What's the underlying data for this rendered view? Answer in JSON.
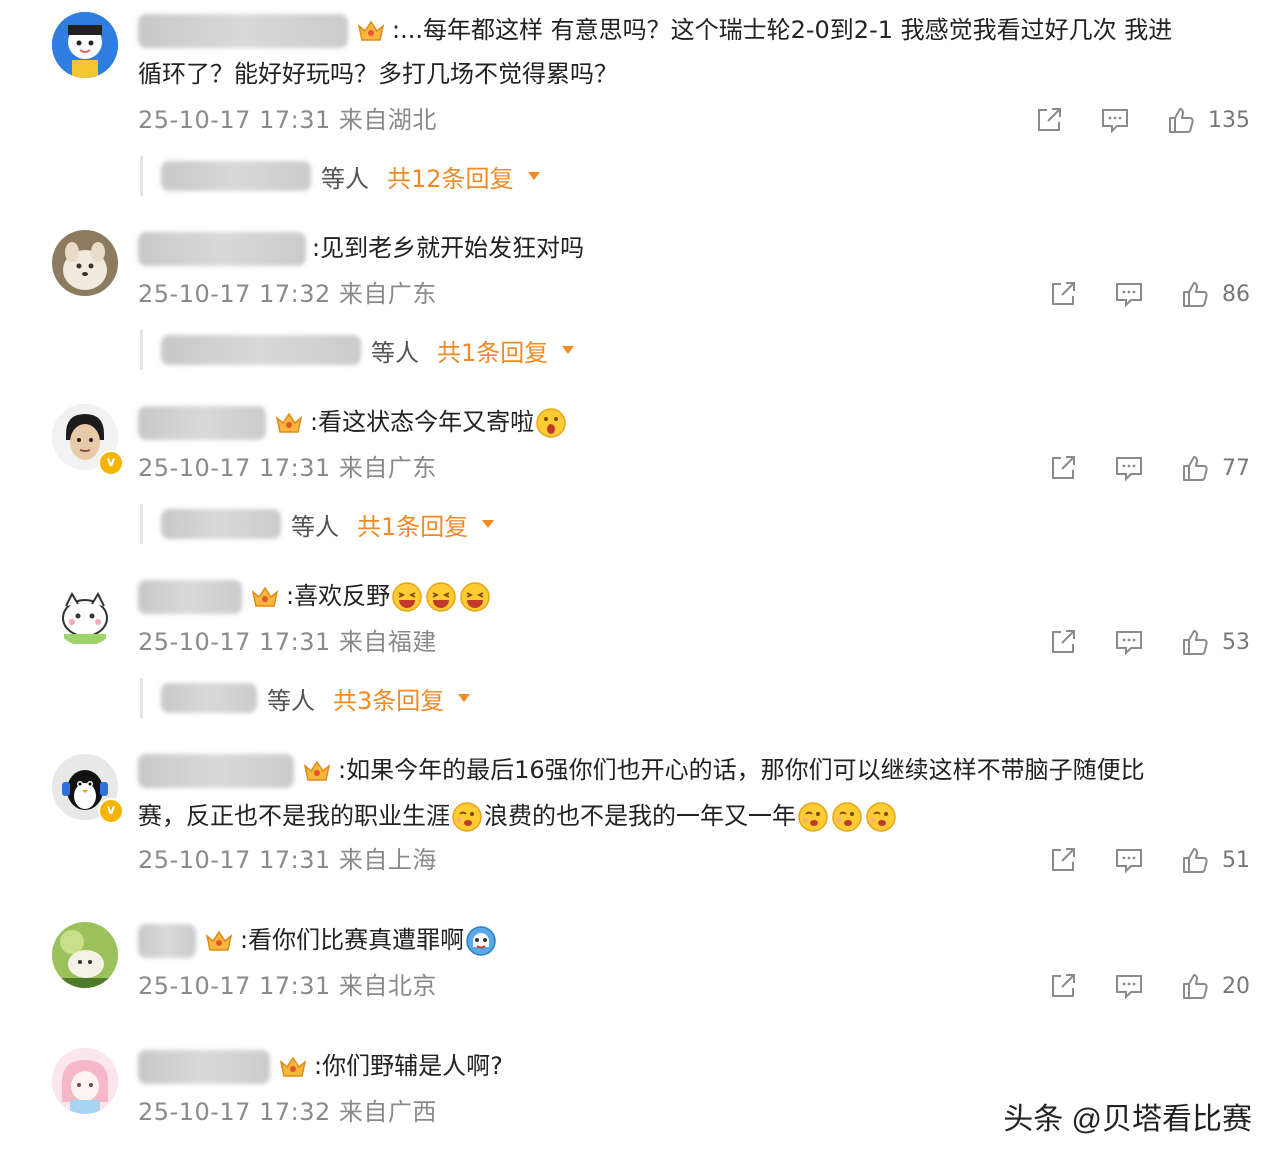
{
  "colors": {
    "accent": "#f08a24",
    "meta": "#8a8a8a",
    "text": "#222222"
  },
  "comments": [
    {
      "text_l1": ":...每年都这样 有意思吗？这个瑞士轮2-0到2-1 我感觉我看过好几次 我进",
      "text_l2": "循环了？能好好玩吗？多打几场不觉得累吗？",
      "time": "25-10-17 17:31",
      "location": "来自湖北",
      "likes": "135",
      "reply_who": "等人",
      "reply_total": "共12条回复"
    },
    {
      "text_l1": ":见到老乡就开始发狂对吗",
      "time": "25-10-17 17:32",
      "location": "来自广东",
      "likes": "86",
      "reply_who": "等人",
      "reply_total": "共1条回复"
    },
    {
      "text_l1": ":看这状态今年又寄啦",
      "time": "25-10-17 17:31",
      "location": "来自广东",
      "likes": "77",
      "reply_who": "等人",
      "reply_total": "共1条回复"
    },
    {
      "text_l1": ":喜欢反野",
      "time": "25-10-17 17:31",
      "location": "来自福建",
      "likes": "53",
      "reply_who": "等人",
      "reply_total": "共3条回复"
    },
    {
      "text_l1": ":如果今年的最后16强你们也开心的话，那你们可以继续这样不带脑子随便比",
      "text_l2a": "赛，反正也不是我的职业生涯",
      "text_l2b": "浪费的也不是我的一年又一年",
      "time": "25-10-17 17:31",
      "location": "来自上海",
      "likes": "51"
    },
    {
      "text_l1": ":看你们比赛真遭罪啊",
      "time": "25-10-17 17:31",
      "location": "来自北京",
      "likes": "20"
    },
    {
      "text_l1": ":你们野辅是人啊?",
      "time": "25-10-17 17:32",
      "location": "来自广西"
    }
  ],
  "watermark": "头条 @贝塔看比赛"
}
